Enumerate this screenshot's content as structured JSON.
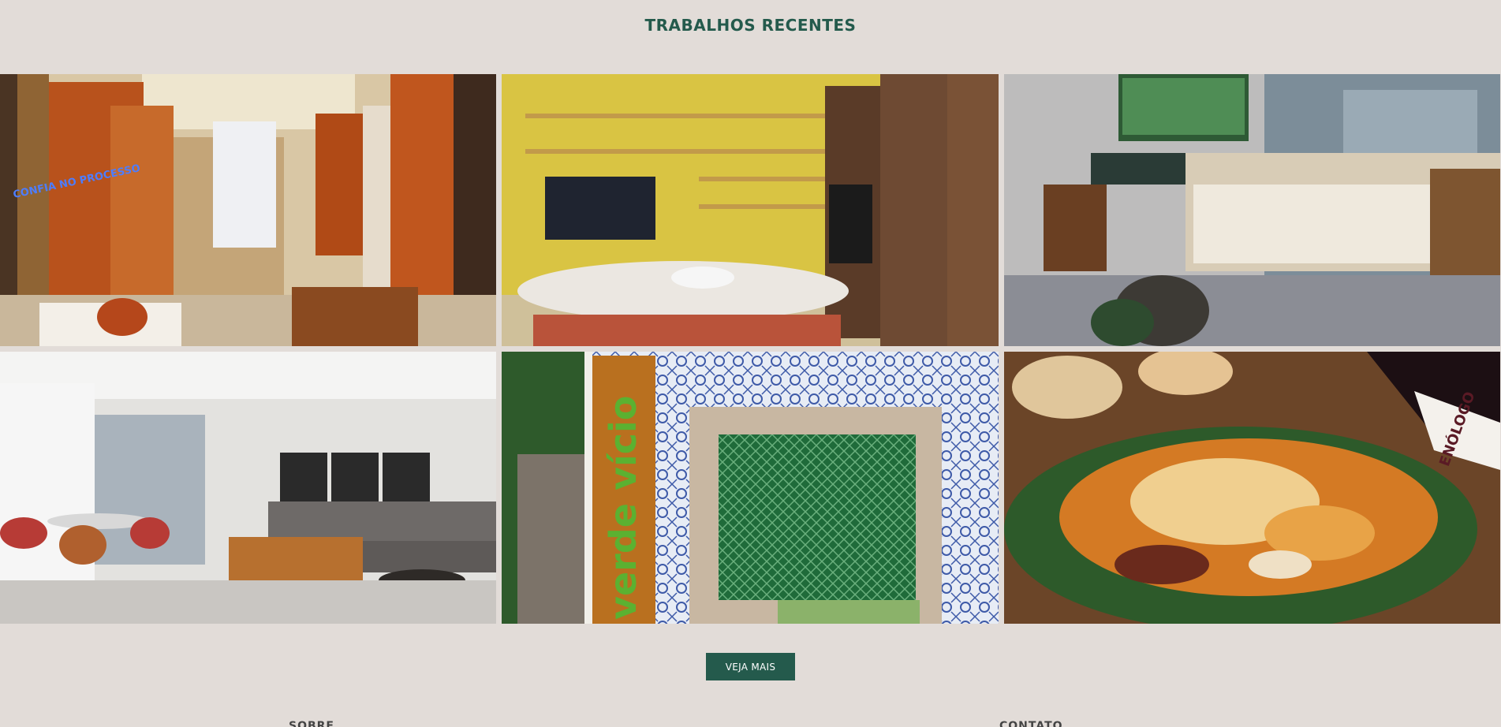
{
  "section": {
    "title": "TRABALHOS RECENTES"
  },
  "gallery": {
    "items": [
      {
        "icon": "photo-office-orange-cabinets",
        "neon_text": "CONFIA NO PROCESSO"
      },
      {
        "icon": "photo-living-room-yellow-shelves"
      },
      {
        "icon": "photo-tv-room-lounge-chair"
      },
      {
        "icon": "photo-living-room-gray-sofa"
      },
      {
        "icon": "photo-facade-tiles-green-window",
        "sign_text": "verde vício"
      },
      {
        "icon": "photo-food-dish-wine-bottle",
        "label_text": "ENÓLOGO"
      }
    ]
  },
  "cta": {
    "more_label": "VEJA MAIS"
  },
  "footer": {
    "about_heading": "SOBRE",
    "contact_heading": "CONTATO"
  },
  "colors": {
    "background": "#e2dcd8",
    "accent": "#245a4c",
    "button_text": "#ffffff"
  }
}
